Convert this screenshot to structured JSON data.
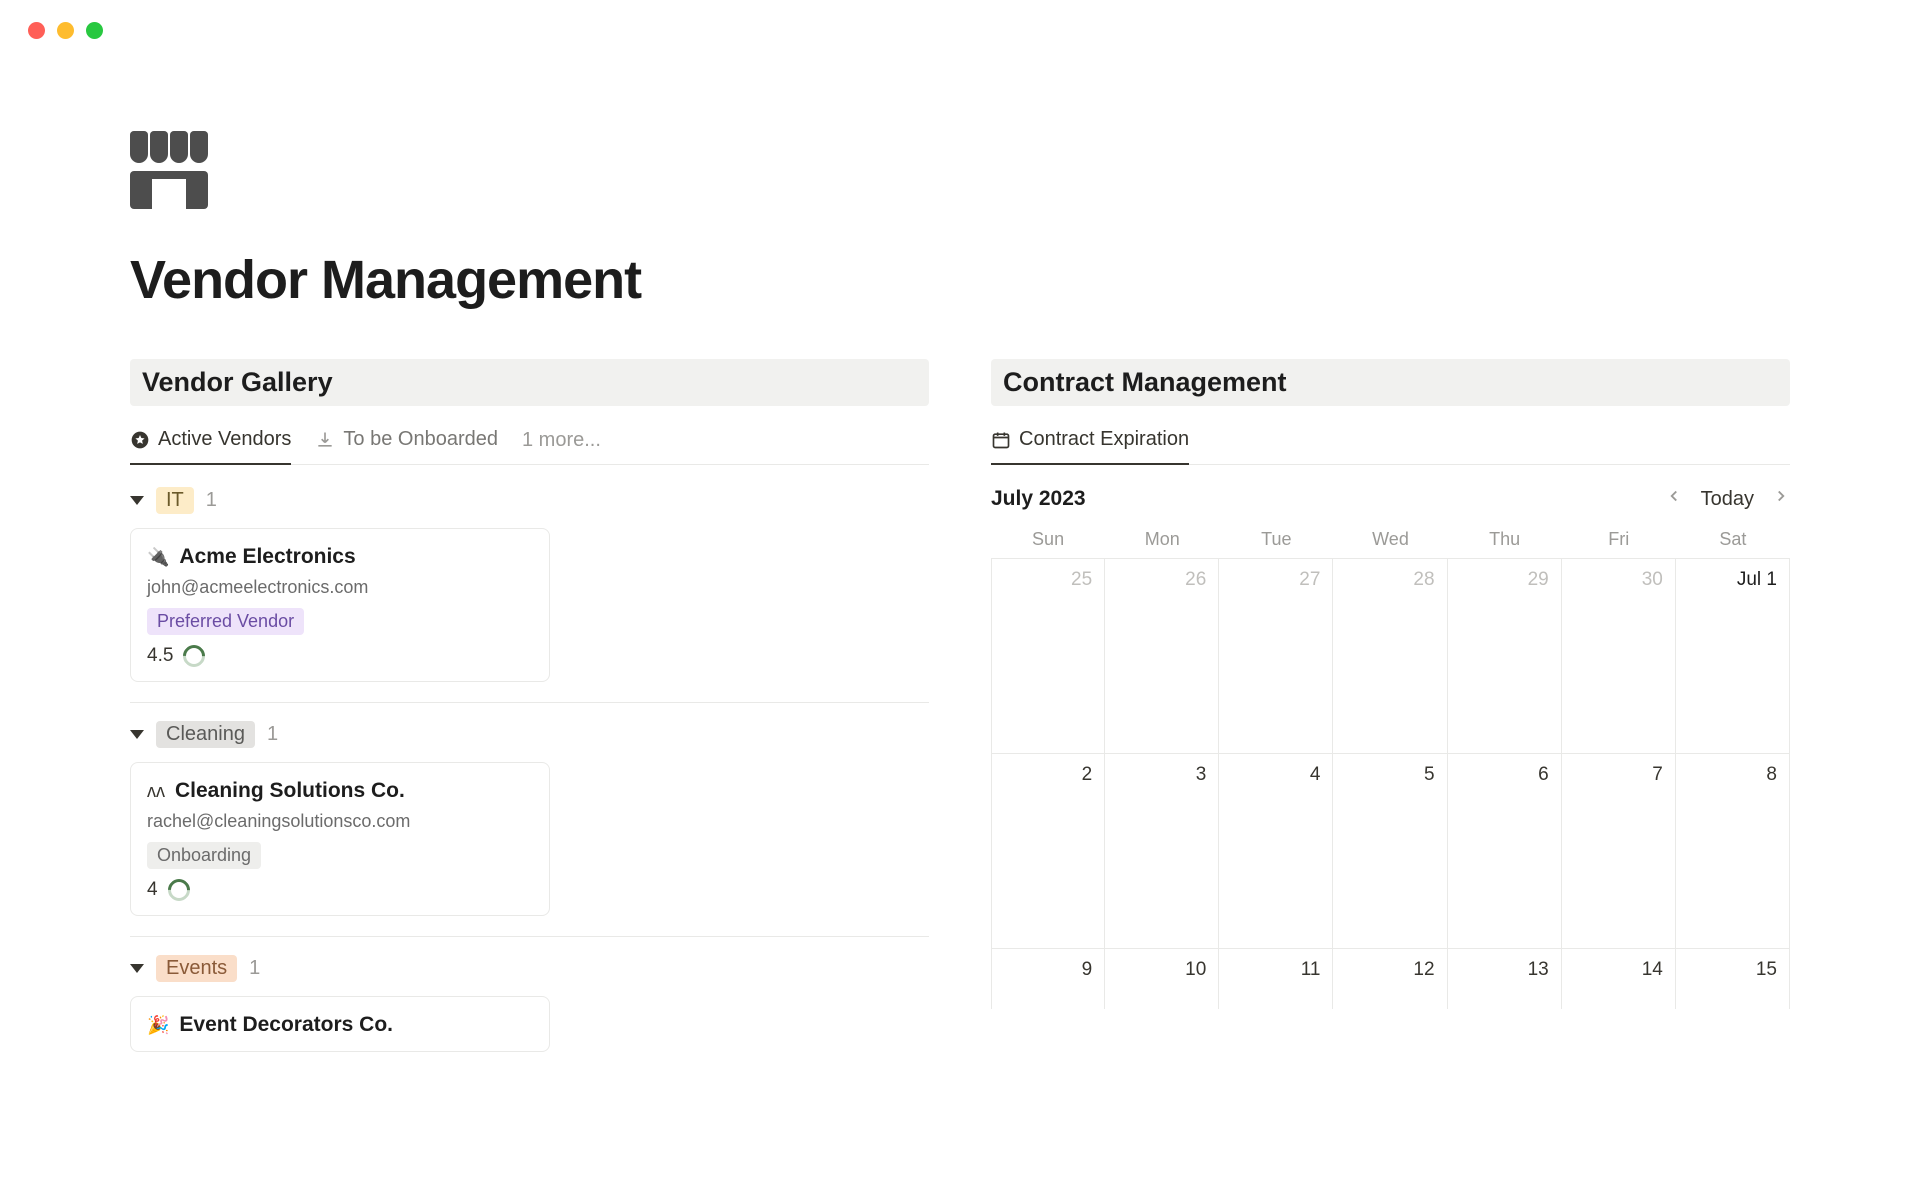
{
  "window": {
    "title": "Vendor Management"
  },
  "page": {
    "title": "Vendor Management"
  },
  "left": {
    "section_title": "Vendor Gallery",
    "tabs": {
      "active": "Active Vendors",
      "onboard": "To be Onboarded",
      "more": "1 more..."
    },
    "groups": [
      {
        "label": "IT",
        "count": "1",
        "tag_class": "tag-it",
        "card": {
          "icon": "🔌",
          "name": "Acme Electronics",
          "email": "john@acmeelectronics.com",
          "badge": "Preferred Vendor",
          "badge_class": "badge-preferred",
          "rating": "4.5"
        }
      },
      {
        "label": "Cleaning",
        "count": "1",
        "tag_class": "tag-cleaning",
        "card": {
          "icon": "ᴧᴧ",
          "name": "Cleaning Solutions Co.",
          "email": "rachel@cleaningsolutionsco.com",
          "badge": "Onboarding",
          "badge_class": "badge-onboarding",
          "rating": "4"
        }
      },
      {
        "label": "Events",
        "count": "1",
        "tag_class": "tag-events",
        "card": {
          "icon": "🎉",
          "name": "Event Decorators Co.",
          "email": "",
          "badge": "",
          "badge_class": "",
          "rating": ""
        }
      }
    ]
  },
  "right": {
    "section_title": "Contract Management",
    "tab": "Contract Expiration",
    "month": "July 2023",
    "today": "Today",
    "weekdays": [
      "Sun",
      "Mon",
      "Tue",
      "Wed",
      "Thu",
      "Fri",
      "Sat"
    ],
    "cells": [
      {
        "d": "25",
        "other": true
      },
      {
        "d": "26",
        "other": true
      },
      {
        "d": "27",
        "other": true
      },
      {
        "d": "28",
        "other": true
      },
      {
        "d": "29",
        "other": true
      },
      {
        "d": "30",
        "other": true
      },
      {
        "d": "Jul 1",
        "first": true
      },
      {
        "d": "2"
      },
      {
        "d": "3"
      },
      {
        "d": "4"
      },
      {
        "d": "5"
      },
      {
        "d": "6"
      },
      {
        "d": "7"
      },
      {
        "d": "8"
      },
      {
        "d": "9"
      },
      {
        "d": "10"
      },
      {
        "d": "11"
      },
      {
        "d": "12"
      },
      {
        "d": "13"
      },
      {
        "d": "14"
      },
      {
        "d": "15"
      }
    ]
  }
}
